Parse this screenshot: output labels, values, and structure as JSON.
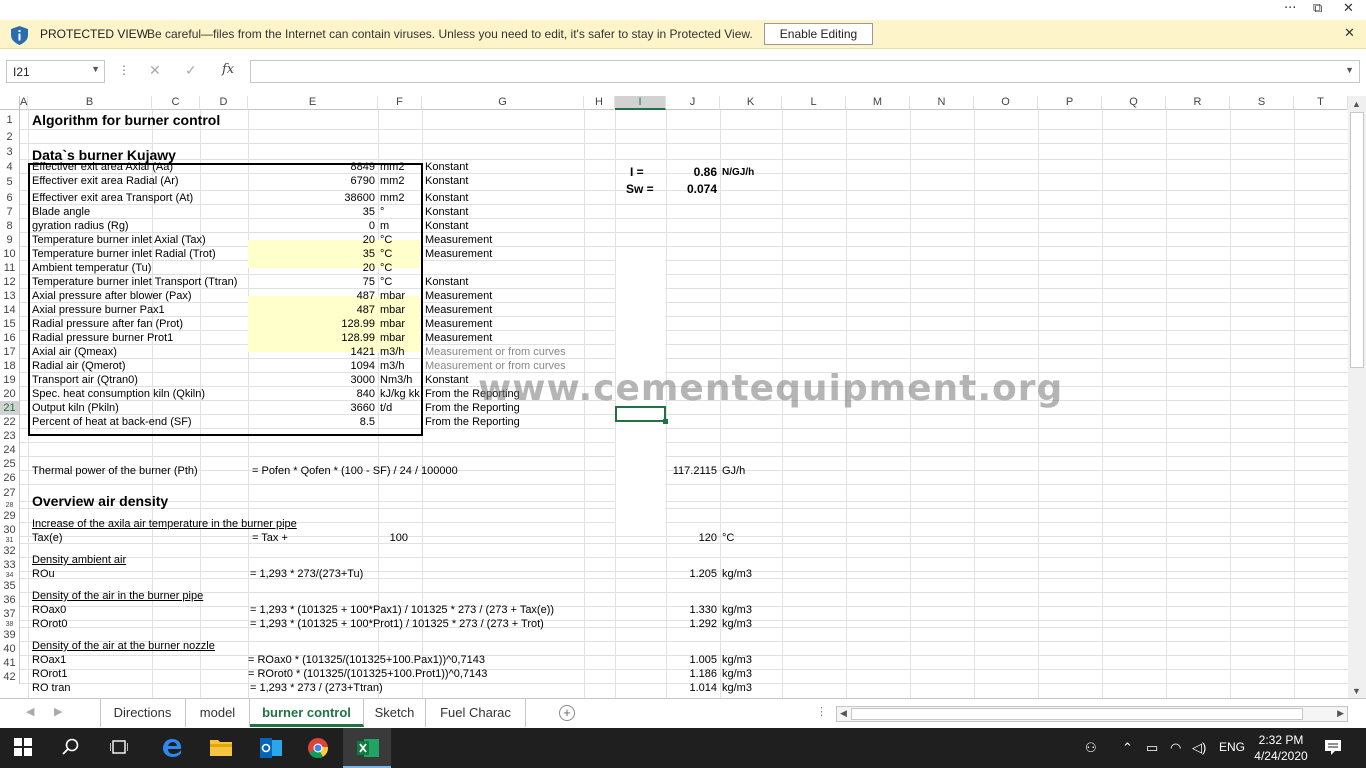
{
  "window": {
    "more": "···",
    "restore": "⧉",
    "close": "✕"
  },
  "protected_view": {
    "title": "PROTECTED VIEW",
    "message": "Be careful—files from the Internet can contain viruses. Unless you need to edit, it's safer to stay in Protected View.",
    "button": "Enable Editing",
    "close": "✕"
  },
  "formula_bar": {
    "name_box": "I21",
    "fx": "fx",
    "content": ""
  },
  "columns": [
    "A",
    "B",
    "C",
    "D",
    "E",
    "F",
    "G",
    "H",
    "I",
    "J",
    "K",
    "L",
    "M",
    "N",
    "O",
    "P",
    "Q",
    "R",
    "S",
    "T"
  ],
  "rows": [
    "1",
    "2",
    "3",
    "4",
    "5",
    "6",
    "7",
    "8",
    "9",
    "10",
    "11",
    "12",
    "13",
    "14",
    "15",
    "16",
    "17",
    "18",
    "19",
    "20",
    "21",
    "22",
    "23",
    "24",
    "25",
    "26",
    "27",
    "28",
    "29",
    "30",
    "31",
    "32",
    "33",
    "34",
    "35",
    "36",
    "37",
    "38",
    "39",
    "40",
    "41",
    "42"
  ],
  "sheet": {
    "title": "Algorithm for burner control",
    "section_data": "Data`s burner Kujawy",
    "params": [
      {
        "label": "Effectiver exit area Axial   (Aa)",
        "value": "8849",
        "unit": "mm2",
        "note": "Konstant"
      },
      {
        "label": "Effectiver exit area Radial   (Ar)",
        "value": "6790",
        "unit": "mm2",
        "note": "Konstant"
      },
      {
        "label": "Effectiver exit area Transport   (At)",
        "value": "38600",
        "unit": "mm2",
        "note": "Konstant"
      },
      {
        "label": "Blade angle",
        "value": "35",
        "unit": "°",
        "note": "Konstant"
      },
      {
        "label": "gyration radius   (Rg)",
        "value": "0",
        "unit": "m",
        "note": "Konstant"
      },
      {
        "label": "Temperature burner inlet Axial    (Tax)",
        "value": "20",
        "unit": "°C",
        "note": "Measurement"
      },
      {
        "label": "Temperature burner inlet Radial  (Trot)",
        "value": "35",
        "unit": "°C",
        "note": "Measurement"
      },
      {
        "label": "Ambient temperatur   (Tu)",
        "value": "20",
        "unit": "°C",
        "note": ""
      },
      {
        "label": "Temperature burner inlet Transport   (Ttran)",
        "value": "75",
        "unit": "°C",
        "note": "Konstant"
      },
      {
        "label": "Axial pressure after blower  (Pax)",
        "value": "487",
        "unit": "mbar",
        "note": "Measurement"
      },
      {
        "label": "Axial pressure burner  Pax1",
        "value": "487",
        "unit": "mbar",
        "note": "Measurement"
      },
      {
        "label": "Radial pressure after fan   (Prot)",
        "value": "128.99",
        "unit": "mbar",
        "note": "Measurement"
      },
      {
        "label": "Radial pressure burner Prot1",
        "value": "128.99",
        "unit": "mbar",
        "note": "Measurement"
      },
      {
        "label": "Axial air  (Qmeax)",
        "value": "1421",
        "unit": "m3/h",
        "note": "Measurement or from curves"
      },
      {
        "label": "Radial air  (Qmerot)",
        "value": "1094",
        "unit": "m3/h",
        "note": "Measurement or from curves"
      },
      {
        "label": "Transport air   (Qtran0)",
        "value": "3000",
        "unit": "Nm3/h",
        "note": "Konstant"
      },
      {
        "label": "Spec. heat consumption kiln  (Qkiln)",
        "value": "840",
        "unit": "kJ/kg kk",
        "note": "From the Reporting"
      },
      {
        "label": "Output kiln   (Pkiln)",
        "value": "3660",
        "unit": "t/d",
        "note": "From the Reporting"
      },
      {
        "label": "Percent of heat at back-end  (SF)",
        "value": "8.5",
        "unit": "",
        "note": "From the Reporting"
      }
    ],
    "side": {
      "i_label": "I =",
      "i_value": "0.86",
      "i_unit": "N/GJ/h",
      "sw_label": "Sw =",
      "sw_value": "0.074"
    },
    "thermal": {
      "label": "Thermal power of the burner   (Pth)",
      "formula": "= Pofen * Qofen * (100 - SF) / 24 / 100000",
      "value": "117.2115",
      "unit": "GJ/h"
    },
    "overview": "Overview air density",
    "inc_title": "Increase of the axila air temperature in the burner pipe",
    "tax": {
      "label": "Tax(e)",
      "formula": "= Tax +",
      "add": "100",
      "value": "120",
      "unit": "°C"
    },
    "amb_title": "Density ambient air",
    "rou": {
      "label": "ROu",
      "formula": "= 1,293 * 273/(273+Tu)",
      "value": "1.205",
      "unit": "kg/m3"
    },
    "pipe_title": "Density of the air in the burner pipe",
    "roax0": {
      "label": "ROax0",
      "formula": "= 1,293 * (101325 + 100*Pax1) / 101325 * 273 / (273 + Tax(e))",
      "value": "1.330",
      "unit": "kg/m3"
    },
    "rorot0": {
      "label": "ROrot0",
      "formula": "= 1,293 * (101325 + 100*Prot1) / 101325 * 273 / (273 + Trot)",
      "value": "1.292",
      "unit": "kg/m3"
    },
    "nozzle_title": "Density of the air at the burner nozzle",
    "roax1": {
      "label": "ROax1",
      "formula": "= ROax0 * (101325/(101325+100.Pax1))^0,7143",
      "value": "1.005",
      "unit": "kg/m3"
    },
    "rorot1": {
      "label": "ROrot1",
      "formula": "= ROrot0 * (101325/(101325+100.Prot1))^0,7143",
      "value": "1.186",
      "unit": "kg/m3"
    },
    "rotran": {
      "label": "RO tran",
      "formula": "= 1,293 * 273 / (273+Ttran)",
      "value": "1.014",
      "unit": "kg/m3"
    }
  },
  "watermark": "www.cementequipment.org",
  "tabs": [
    "Directions",
    "model",
    "burner control",
    "Sketch",
    "Fuel Charac"
  ],
  "active_tab": "burner control",
  "taskbar": {
    "time": "2:32 PM",
    "date": "4/24/2020",
    "lang": "ENG"
  }
}
